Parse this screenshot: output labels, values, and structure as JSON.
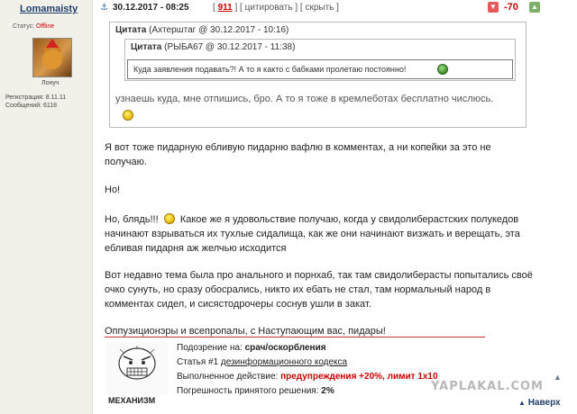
{
  "user": {
    "name": "Lomamaisty",
    "status_label": "Статус:",
    "status_value": "Offline",
    "rank": "Лонуч",
    "reg_label": "Регистрация: 8.11.11",
    "posts_label": "Сообщений: 6118"
  },
  "header": {
    "date": "30.12.2017 - 08:25",
    "open_bracket": "[",
    "post_number": "911",
    "sep1": "] [",
    "cite_label": "цитировать",
    "sep2": "] [",
    "hide_label": "скрыть",
    "close_bracket": "]",
    "rating": "-70"
  },
  "quote_outer": {
    "head_label": "Цитата",
    "head_meta": "(Ахтерштаг @ 30.12.2017 - 10:16)",
    "text": "узнаешь куда, мне отпишись, бро. А то я тоже в кремлеботах бесплатно числюсь."
  },
  "quote_inner": {
    "head_label": "Цитата",
    "head_meta": "(РЫБА67 @ 30.12.2017 - 11:38)",
    "text": "Куда заявления подавать?! А то я както с бабками пролетаю постоянно!"
  },
  "post": {
    "p1a": "Я вот тоже пидарную ебливую пидарню вафлю в комментах, а ни копейки за это не",
    "p1b": "получаю.",
    "p2": "Но!",
    "p3a_start": "Но, блядь!!!",
    "p3a_end": "Какое же я удовольствие получаю, когда у свидолиберастских полукедов",
    "p3b": "начинают взрываться их тухлые сидалища, как же они начинают визжать и верещать, эта",
    "p3c": "ебливая пидарня аж желчью исходится",
    "p4a": "Вот недавно тема была про анального и порнхаб, так там свидолиберасты попытались своё",
    "p4b": "очко сунуть, но сразу обосрались, никто их ебать не стал, там нормальный народ в",
    "p4c": "комментах сидел, и сисястодрочеры соснув ушли в закат.",
    "p5": "Оппузиционэры и всепропалы, с Наступающим вас, пидары!"
  },
  "signature": {
    "label": "МЕХАНИЗМ",
    "line1_label": "Подозрение на:",
    "line1_value": "срач/оскорбления",
    "line2_label": "Статья #1",
    "line2_value": "дезинформационного кодекса",
    "line3_label": "Выполненное действие:",
    "line3_value": "предупреждения +20%, лимит 1x10",
    "line4_label": "Погрешность принятого решения:",
    "line4_value": "2%"
  },
  "footer": {
    "logo": "YAPLAKAL.COM",
    "back": "Наверх"
  },
  "icons": [
    "anchor-icon",
    "thumb-down-icon",
    "thumb-up-icon",
    "smile-icon",
    "rage-face-icon",
    "arrow-up-icon"
  ],
  "colors": {
    "accent": "#cc0000",
    "link": "#21406d",
    "sidebar_bg": "#f1f1ea"
  }
}
